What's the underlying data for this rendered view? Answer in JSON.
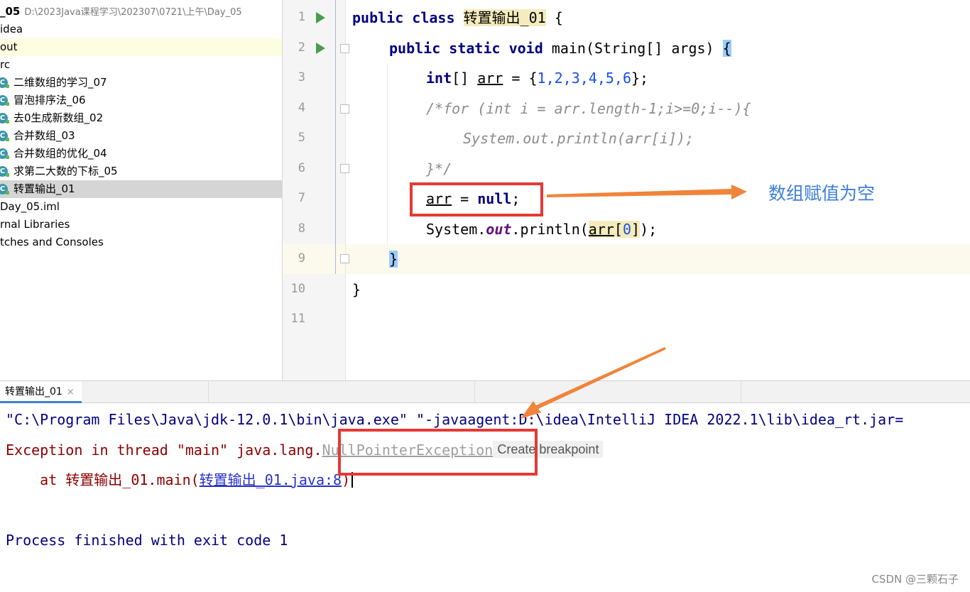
{
  "project": {
    "root_name": "_05",
    "root_path": "D:\\2023Java课程学习\\202307\\0721\\上午\\Day_05",
    "items": [
      {
        "label": "idea"
      },
      {
        "label": "out"
      },
      {
        "label": "rc"
      },
      {
        "label": "二维数组的学习_07"
      },
      {
        "label": "冒泡排序法_06"
      },
      {
        "label": "去0生成新数组_02"
      },
      {
        "label": "合并数组_03"
      },
      {
        "label": "合并数组的优化_04"
      },
      {
        "label": "求第二大数的下标_05"
      },
      {
        "label": "转置输出_01"
      },
      {
        "label": "Day_05.iml"
      },
      {
        "label": "rnal Libraries"
      },
      {
        "label": "tches and Consoles"
      }
    ],
    "class_icon_letter": "C"
  },
  "editor": {
    "line_numbers": [
      "1",
      "2",
      "3",
      "4",
      "5",
      "6",
      "7",
      "8",
      "9",
      "10",
      "11"
    ],
    "code": {
      "l1_kw": "public class ",
      "l1_name": "转置输出_01",
      "l1_tail": " {",
      "l2_kw": "public static void ",
      "l2_mid": "main(String[] args) ",
      "l2_brace": "{",
      "l3_kw": "int",
      "l3_a": "[] ",
      "l3_var": "arr",
      "l3_b": " = {",
      "l3_nums": "1,2,3,4,5,6",
      "l3_c": "};",
      "l4": "/*for (int i = arr.length-1;i>=0;i--){",
      "l5": "System.out.println(arr[i]);",
      "l6": "}*/",
      "l7_var": "arr",
      "l7_a": " = ",
      "l7_kw": "null",
      "l7_b": ";",
      "l8_a": "System.",
      "l8_fld": "out",
      "l8_b": ".println(",
      "l8_var": "arr",
      "l8_c": "[",
      "l8_num": "0",
      "l8_d": "]",
      "l8_e": ");",
      "l9_brace": "}",
      "l10_brace": "}"
    }
  },
  "annotation": {
    "text": "数组赋值为空"
  },
  "run": {
    "tab_label": "转置输出_01",
    "tab_close": "×",
    "cmd_line": "\"C:\\Program Files\\Java\\jdk-12.0.1\\bin\\java.exe\" \"-javaagent:D:\\idea\\IntelliJ IDEA 2022.1\\lib\\idea_rt.jar=",
    "exc_prefix": "Exception in thread \"main\" java.lang.",
    "exc_name": "NullPointerException",
    "create_bp": "Create breakpoint",
    "at_prefix": "    at 转置输出_01.main(",
    "at_link": "转置输出_01.java:8",
    "at_suffix": ")",
    "finished": "Process finished with exit code 1"
  },
  "watermark": "CSDN @三颗石子",
  "colors": {
    "keyword": "#000080",
    "comment": "#8c8c8c",
    "number": "#1750eb",
    "error": "#8b0000",
    "annotation_red": "#e53935",
    "annotation_text": "#3d7edb",
    "arrow": "#f0843a"
  }
}
